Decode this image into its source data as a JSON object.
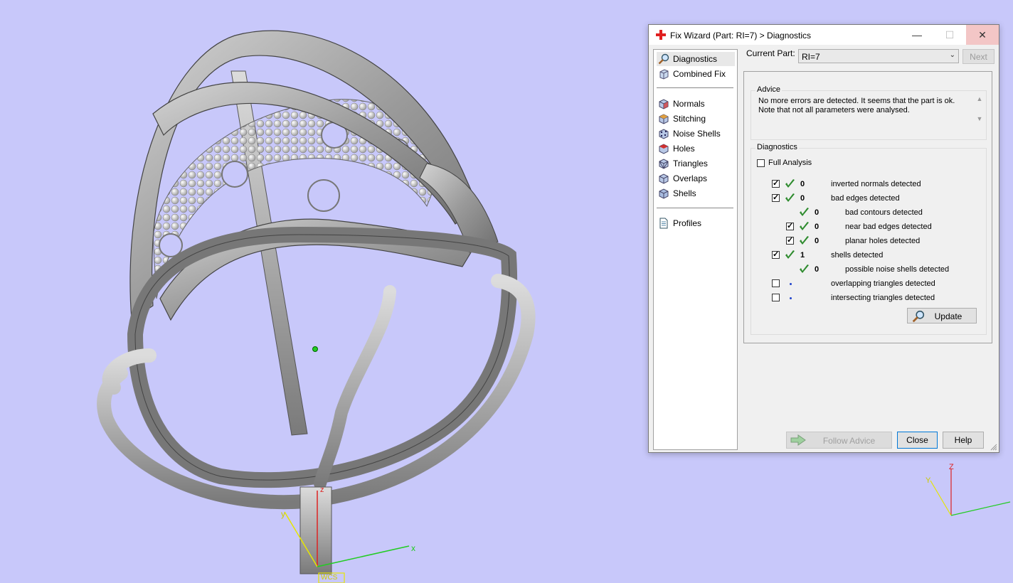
{
  "dialog": {
    "title": "Fix Wizard (Part: RI=7) > Diagnostics",
    "controls": {
      "minimize": "—",
      "maximize": "☐",
      "close": "✕"
    }
  },
  "nav": {
    "top": [
      {
        "label": "Diagnostics",
        "icon": "magnifier-icon",
        "selected": true
      },
      {
        "label": "Combined Fix",
        "icon": "cube-icon"
      }
    ],
    "fixes": [
      {
        "label": "Normals",
        "icon": "normals-cube-icon"
      },
      {
        "label": "Stitching",
        "icon": "stitching-cube-icon"
      },
      {
        "label": "Noise Shells",
        "icon": "noise-shells-icon"
      },
      {
        "label": "Holes",
        "icon": "holes-cube-icon"
      },
      {
        "label": "Triangles",
        "icon": "triangles-cube-icon"
      },
      {
        "label": "Overlaps",
        "icon": "overlaps-cube-icon"
      },
      {
        "label": "Shells",
        "icon": "shells-cube-icon"
      }
    ],
    "bottom": [
      {
        "label": "Profiles",
        "icon": "document-icon"
      }
    ]
  },
  "current_part": {
    "label": "Current Part:",
    "value": "RI=7"
  },
  "next_label": "Next",
  "advice": {
    "title": "Advice",
    "line1": "No more errors are detected. It seems that the part is ok.",
    "line2": "Note that not all parameters were analysed."
  },
  "diagnostics": {
    "title": "Diagnostics",
    "full_analysis": "Full Analysis",
    "rows": [
      {
        "checkbox": true,
        "checked": true,
        "status": "ok",
        "count": "0",
        "label": "inverted normals detected",
        "indent": 0
      },
      {
        "checkbox": true,
        "checked": true,
        "status": "ok",
        "count": "0",
        "label": "bad edges detected",
        "indent": 0
      },
      {
        "checkbox": false,
        "checked": false,
        "status": "ok",
        "count": "0",
        "label": "bad contours detected",
        "indent": 1
      },
      {
        "checkbox": true,
        "checked": true,
        "status": "ok",
        "count": "0",
        "label": "near bad edges detected",
        "indent": 1
      },
      {
        "checkbox": true,
        "checked": true,
        "status": "ok",
        "count": "0",
        "label": "planar holes detected",
        "indent": 1
      },
      {
        "checkbox": true,
        "checked": true,
        "status": "ok",
        "count": "1",
        "label": "shells detected",
        "indent": 0
      },
      {
        "checkbox": false,
        "checked": false,
        "status": "ok",
        "count": "0",
        "label": "possible noise shells detected",
        "indent": 1
      },
      {
        "checkbox": true,
        "checked": false,
        "status": "pending",
        "count": "",
        "label": "overlapping triangles detected",
        "indent": 0
      },
      {
        "checkbox": true,
        "checked": false,
        "status": "pending",
        "count": "",
        "label": "intersecting triangles detected",
        "indent": 0
      }
    ]
  },
  "buttons": {
    "update": "Update",
    "follow_advice": "Follow Advice",
    "close": "Close",
    "help": "Help"
  },
  "viewport": {
    "axis_main": {
      "x": "x",
      "y": "y",
      "z": "z",
      "footer": "WCS"
    },
    "axis_corner": {
      "z": "Z",
      "y": "Y"
    }
  },
  "colors": {
    "background": "#c8c8fa",
    "model": "#a8a8a8",
    "ok_check": "#2e8b2e",
    "axis_x": "#22cc22",
    "axis_y": "#e6e600",
    "axis_z": "#dd2222"
  }
}
